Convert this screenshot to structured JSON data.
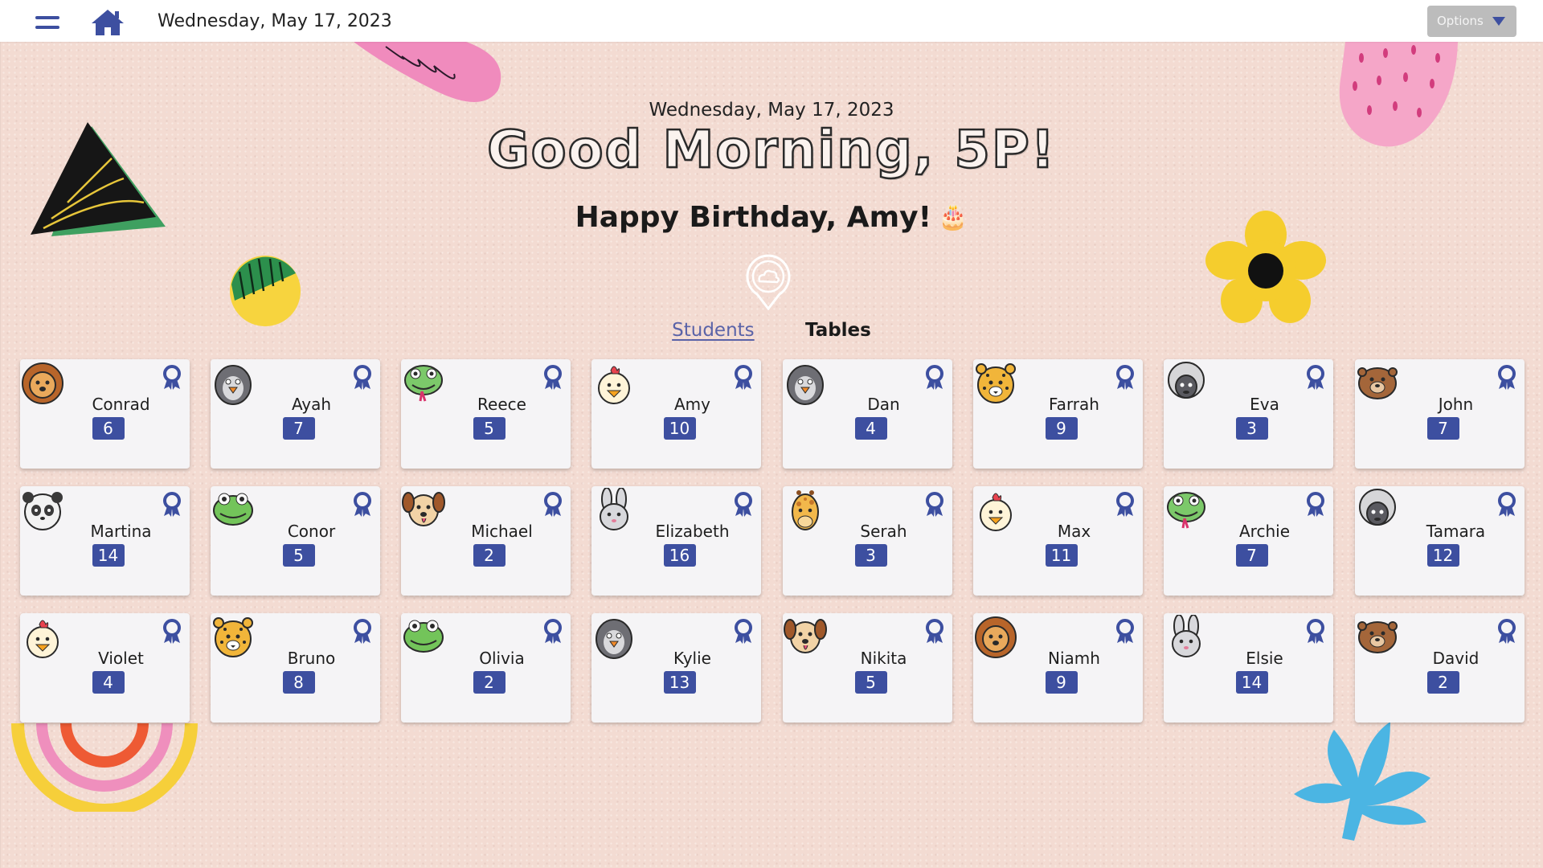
{
  "topbar": {
    "date": "Wednesday, May 17, 2023",
    "options_label": "Options"
  },
  "header": {
    "date": "Wednesday, May 17, 2023",
    "greeting": "Good Morning, 5P!",
    "birthday": "Happy Birthday, Amy!",
    "birthday_emoji": "🎂"
  },
  "tabs": [
    {
      "label": "Students",
      "active": true
    },
    {
      "label": "Tables",
      "active": false
    }
  ],
  "students": [
    {
      "name": "Conrad",
      "points": "6",
      "avatar": "lion"
    },
    {
      "name": "Ayah",
      "points": "7",
      "avatar": "penguin"
    },
    {
      "name": "Reece",
      "points": "5",
      "avatar": "snake"
    },
    {
      "name": "Amy",
      "points": "10",
      "avatar": "chick"
    },
    {
      "name": "Dan",
      "points": "4",
      "avatar": "penguin"
    },
    {
      "name": "Farrah",
      "points": "9",
      "avatar": "leopard"
    },
    {
      "name": "Eva",
      "points": "3",
      "avatar": "sheep"
    },
    {
      "name": "John",
      "points": "7",
      "avatar": "otter"
    },
    {
      "name": "Martina",
      "points": "14",
      "avatar": "panda"
    },
    {
      "name": "Conor",
      "points": "5",
      "avatar": "frog"
    },
    {
      "name": "Michael",
      "points": "2",
      "avatar": "dog"
    },
    {
      "name": "Elizabeth",
      "points": "16",
      "avatar": "rabbit"
    },
    {
      "name": "Serah",
      "points": "3",
      "avatar": "giraffe"
    },
    {
      "name": "Max",
      "points": "11",
      "avatar": "chick"
    },
    {
      "name": "Archie",
      "points": "7",
      "avatar": "snake"
    },
    {
      "name": "Tamara",
      "points": "12",
      "avatar": "sheep"
    },
    {
      "name": "Violet",
      "points": "4",
      "avatar": "chick"
    },
    {
      "name": "Bruno",
      "points": "8",
      "avatar": "leopard"
    },
    {
      "name": "Olivia",
      "points": "2",
      "avatar": "frog"
    },
    {
      "name": "Kylie",
      "points": "13",
      "avatar": "penguin"
    },
    {
      "name": "Nikita",
      "points": "5",
      "avatar": "dog"
    },
    {
      "name": "Niamh",
      "points": "9",
      "avatar": "lion"
    },
    {
      "name": "Elsie",
      "points": "14",
      "avatar": "rabbit"
    },
    {
      "name": "David",
      "points": "2",
      "avatar": "otter"
    }
  ],
  "colors": {
    "accent": "#3d4fa0",
    "background": "#f3dbd2",
    "card": "#f5f4f6"
  }
}
